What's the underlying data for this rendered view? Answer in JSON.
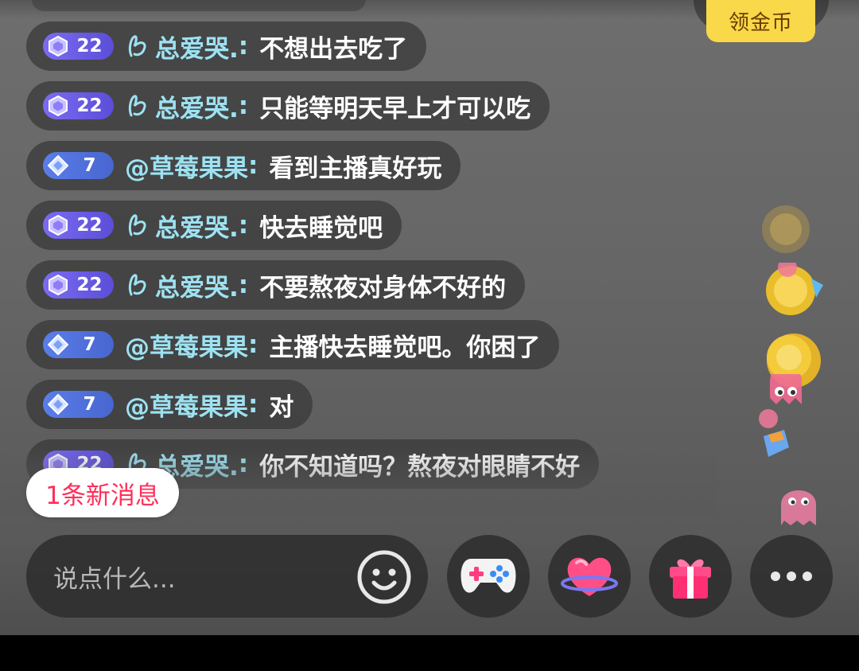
{
  "top": {
    "coin_button_label": "领金币"
  },
  "messages": [
    {
      "level": "22",
      "tier": "hexagon-purple",
      "username": "总爱哭.",
      "sep": ":",
      "text": "不想出去吃了"
    },
    {
      "level": "22",
      "tier": "hexagon-purple",
      "username": "总爱哭.",
      "sep": ":",
      "text": "只能等明天早上才可以吃"
    },
    {
      "level": "7",
      "tier": "diamond-blue",
      "username": "@草莓果果",
      "sep": ":",
      "text": "看到主播真好玩"
    },
    {
      "level": "22",
      "tier": "hexagon-purple",
      "username": "总爱哭.",
      "sep": ":",
      "text": "快去睡觉吧"
    },
    {
      "level": "22",
      "tier": "hexagon-purple",
      "username": "总爱哭.",
      "sep": ":",
      "text": "不要熬夜对身体不好的"
    },
    {
      "level": "7",
      "tier": "diamond-blue",
      "username": "@草莓果果",
      "sep": ":",
      "text": "主播快去睡觉吧。你困了"
    },
    {
      "level": "7",
      "tier": "diamond-blue",
      "username": "@草莓果果",
      "sep": ":",
      "text": "对"
    },
    {
      "level": "22",
      "tier": "hexagon-purple",
      "username": "总爱哭.",
      "sep": ":",
      "text": "你不知道吗？熬夜对眼睛不好"
    }
  ],
  "new_messages_pill": "1条新消息",
  "input": {
    "placeholder": "说点什么..."
  },
  "toolbar": {
    "emoji_icon": "smiley-icon",
    "game_icon": "gamepad-icon",
    "like_icon": "heart-planet-icon",
    "gift_icon": "gift-box-icon",
    "more_icon": "more-dots-icon"
  },
  "colors": {
    "username": "#9de2f2",
    "coin_button_bg": "#f9d84a",
    "new_msg_text": "#ff2f5a",
    "badge_purple": "#6b5ce6",
    "badge_blue": "#5271db"
  }
}
